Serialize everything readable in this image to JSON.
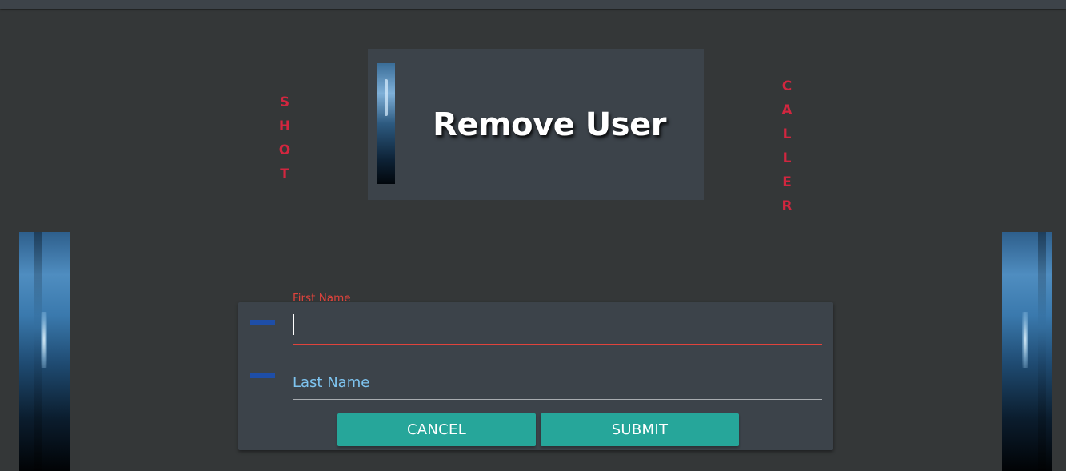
{
  "side_text": {
    "left": [
      "S",
      "H",
      "O",
      "T"
    ],
    "right": [
      "C",
      "A",
      "L",
      "L",
      "E",
      "R"
    ]
  },
  "title": "Remove User",
  "form": {
    "first_name": {
      "label": "First Name",
      "value": ""
    },
    "last_name": {
      "placeholder": "Last Name",
      "value": ""
    },
    "cancel_label": "CANCEL",
    "submit_label": "SUBMIT"
  },
  "colors": {
    "background": "#343738",
    "card": "#3c434a",
    "accent_text": "#d2263f",
    "active_field": "#e0433c",
    "button": "#26a69a",
    "field_icon": "#1e4ea8"
  },
  "icons": {
    "first_name_icon": "field-marker-icon",
    "last_name_icon": "field-marker-icon"
  }
}
